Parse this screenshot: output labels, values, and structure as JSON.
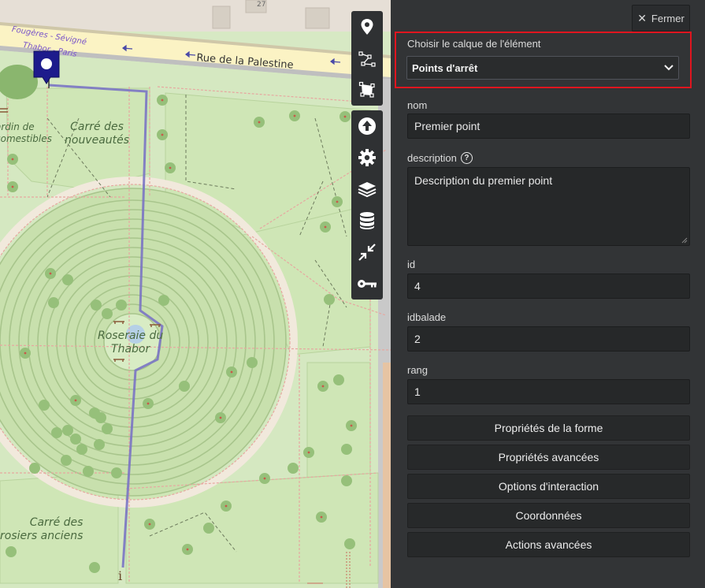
{
  "map": {
    "street_name": "Rue de la Palestine",
    "bus_stop": "Fougères - Sévigné",
    "bus_stop_line2": "Thabor - Paris",
    "house_number": "27",
    "labels": {
      "carre_nouveautes_1": "Carré des",
      "carre_nouveautes_2": "nouveautés",
      "jardin_1": "ardin de",
      "jardin_2": "comestibles",
      "roseraie_1": "Roseraie du",
      "roseraie_2": "Thabor",
      "rosiers_1": "Carré des",
      "rosiers_2": "rosiers anciens"
    },
    "toolbar": [
      {
        "icon": "marker-icon"
      },
      {
        "icon": "polyline-icon"
      },
      {
        "icon": "polygon-icon"
      },
      {
        "icon": "upload-icon"
      },
      {
        "icon": "settings-icon"
      },
      {
        "icon": "layers-icon"
      },
      {
        "icon": "database-icon"
      },
      {
        "icon": "collapse-arrows-icon"
      },
      {
        "icon": "key-icon"
      }
    ]
  },
  "panel": {
    "close_label": "Fermer",
    "layer_label": "Choisir le calque de l'élément",
    "layer_value": "Points d'arrêt",
    "fields": {
      "nom_label": "nom",
      "nom_value": "Premier point",
      "description_label": "description",
      "description_value": "Description du premier point",
      "id_label": "id",
      "id_value": "4",
      "idbalade_label": "idbalade",
      "idbalade_value": "2",
      "rang_label": "rang",
      "rang_value": "1"
    },
    "sections": [
      "Propriétés de la forme",
      "Propriétés avancées",
      "Options d'interaction",
      "Coordonnées",
      "Actions avancées"
    ]
  },
  "colors": {
    "highlight": "#e0151f",
    "route": "#6e67b8",
    "marker": "#1d1b8c",
    "park": "#d7e9c4",
    "road": "#f7f0c6"
  }
}
